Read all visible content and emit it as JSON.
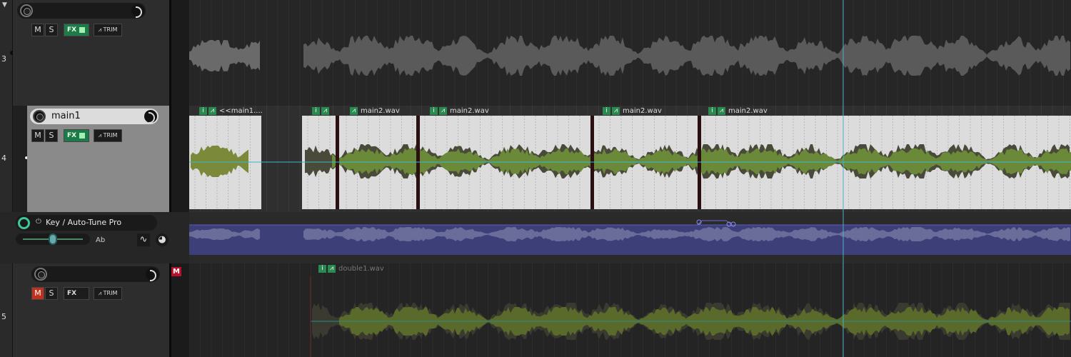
{
  "collapse_icon": "triangle-down-icon",
  "tracks": [
    {
      "number": "3",
      "name": "",
      "mute": "M",
      "solo": "S",
      "fx": "FX",
      "trim": "TRIM",
      "fx_active": true,
      "muted": false,
      "selected": false
    },
    {
      "number": "4",
      "name": "main1",
      "mute": "M",
      "solo": "S",
      "fx": "FX",
      "trim": "TRIM",
      "fx_active": true,
      "muted": false,
      "selected": true
    },
    {
      "number": "5",
      "name": "",
      "mute": "M",
      "solo": "S",
      "fx": "FX",
      "trim": "TRIM",
      "fx_active": false,
      "muted": true,
      "selected": false
    }
  ],
  "fx_lane": {
    "plugin_name": "Key / Auto-Tune Pro",
    "key_value": "Ab",
    "power_icon": "power-icon",
    "curve_icon": "curve-shape-icon",
    "knob_icon": "knob-icon"
  },
  "track5_mute_badge": "M",
  "items": {
    "track4": [
      {
        "label": "<<main1....",
        "i": "i"
      },
      {
        "label": "main2.wav",
        "i": "i"
      },
      {
        "label": "main2.wav",
        "i": "i"
      },
      {
        "label": "main2.wav",
        "i": "i"
      },
      {
        "label": "main2.wav",
        "i": "i"
      }
    ],
    "track5": [
      {
        "label": "double1.wav",
        "i": "i"
      }
    ]
  },
  "colors": {
    "background": "#202020",
    "selected_item": "#dcdcdc",
    "fx_green": "#1e7a48",
    "mute_red": "#c0301c",
    "envelope_lane": "#3d3f78",
    "cursor": "#4fb0c0"
  }
}
